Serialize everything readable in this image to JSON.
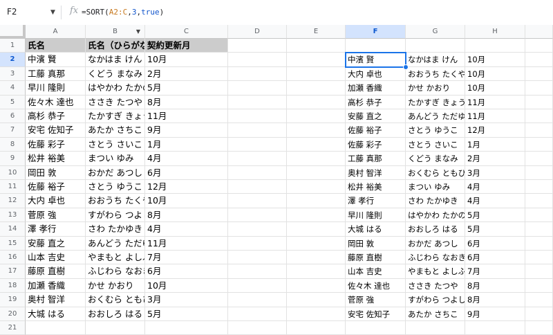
{
  "formula_bar": {
    "name_box": "F2",
    "fx_label": "fx",
    "formula_prefix": "=SORT(",
    "formula_ref": "A2:C",
    "formula_sep1": ",",
    "formula_arg1": "3",
    "formula_sep2": ",",
    "formula_arg2": "true",
    "formula_suffix": ")"
  },
  "columns": [
    "A",
    "B",
    "C",
    "D",
    "E",
    "F",
    "G",
    "H"
  ],
  "selected_column": "F",
  "selected_row": 2,
  "row_numbers": [
    "1",
    "2",
    "3",
    "4",
    "5",
    "6",
    "7",
    "8",
    "9",
    "10",
    "11",
    "12",
    "13",
    "14",
    "15",
    "16",
    "17",
    "18",
    "19",
    "20",
    "21"
  ],
  "header_row": [
    "氏名",
    "氏名（ひらがな）",
    "契約更新月"
  ],
  "rows": [
    {
      "a": "中濱 賢",
      "b": "なかはま けん",
      "c": "10月",
      "f": "中濱 賢",
      "g": "なかはま けん",
      "h": "10月"
    },
    {
      "a": "工藤 真那",
      "b": "くどう まなみ",
      "c": "2月",
      "f": "大内 卓也",
      "g": "おおうち たくや",
      "h": "10月"
    },
    {
      "a": "早川 隆則",
      "b": "はやかわ たかのり",
      "c": "5月",
      "f": "加瀬 香織",
      "g": "かせ かおり",
      "h": "10月"
    },
    {
      "a": "佐々木 達也",
      "b": "ささき たつや",
      "c": "8月",
      "f": "高杉 恭子",
      "g": "たかすぎ きょうこ",
      "h": "11月"
    },
    {
      "a": "高杉 恭子",
      "b": "たかすぎ きょうこ",
      "c": "11月",
      "f": "安藤 直之",
      "g": "あんどう ただゆき",
      "h": "11月"
    },
    {
      "a": "安宅 佐知子",
      "b": "あたか さちこ",
      "c": "9月",
      "f": "佐藤 裕子",
      "g": "さとう ゆうこ",
      "h": "12月"
    },
    {
      "a": "佐藤 彩子",
      "b": "さとう さいこ",
      "c": "1月",
      "f": "佐藤 彩子",
      "g": "さとう さいこ",
      "h": "1月"
    },
    {
      "a": "松井 裕美",
      "b": "まつい ゆみ",
      "c": "4月",
      "f": "工藤 真那",
      "g": "くどう まなみ",
      "h": "2月"
    },
    {
      "a": "岡田 敦",
      "b": "おかだ あつし",
      "c": "6月",
      "f": "奥村 智洋",
      "g": "おくむら ともひろ",
      "h": "3月"
    },
    {
      "a": "佐藤 裕子",
      "b": "さとう ゆうこ",
      "c": "12月",
      "f": "松井 裕美",
      "g": "まつい ゆみ",
      "h": "4月"
    },
    {
      "a": "大内 卓也",
      "b": "おおうち たくや",
      "c": "10月",
      "f": "澤 孝行",
      "g": "さわ たかゆき",
      "h": "4月"
    },
    {
      "a": "菅原 強",
      "b": "すがわら つよし",
      "c": "8月",
      "f": "早川 隆則",
      "g": "はやかわ たかのり",
      "h": "5月"
    },
    {
      "a": "澤 孝行",
      "b": "さわ たかゆき",
      "c": "4月",
      "f": "大城 はる",
      "g": "おおしろ はる",
      "h": "5月"
    },
    {
      "a": "安藤 直之",
      "b": "あんどう ただゆき",
      "c": "11月",
      "f": "岡田 敦",
      "g": "おかだ あつし",
      "h": "6月"
    },
    {
      "a": "山本 吉史",
      "b": "やまもと よしふみ",
      "c": "7月",
      "f": "藤原 直樹",
      "g": "ふじわら なおき",
      "h": "6月"
    },
    {
      "a": "藤原 直樹",
      "b": "ふじわら なおき",
      "c": "6月",
      "f": "山本 吉史",
      "g": "やまもと よしふみ",
      "h": "7月"
    },
    {
      "a": "加瀬 香織",
      "b": "かせ かおり",
      "c": "10月",
      "f": "佐々木 達也",
      "g": "ささき たつや",
      "h": "8月"
    },
    {
      "a": "奥村 智洋",
      "b": "おくむら ともひろ",
      "c": "3月",
      "f": "菅原 強",
      "g": "すがわら つよし",
      "h": "8月"
    },
    {
      "a": "大城 はる",
      "b": "おおしろ はる",
      "c": "5月",
      "f": "安宅 佐知子",
      "g": "あたか さちこ",
      "h": "9月"
    }
  ],
  "icons": {
    "filter": "filter-dropdown-icon",
    "name_box_arrow": "chevron-down-icon"
  }
}
